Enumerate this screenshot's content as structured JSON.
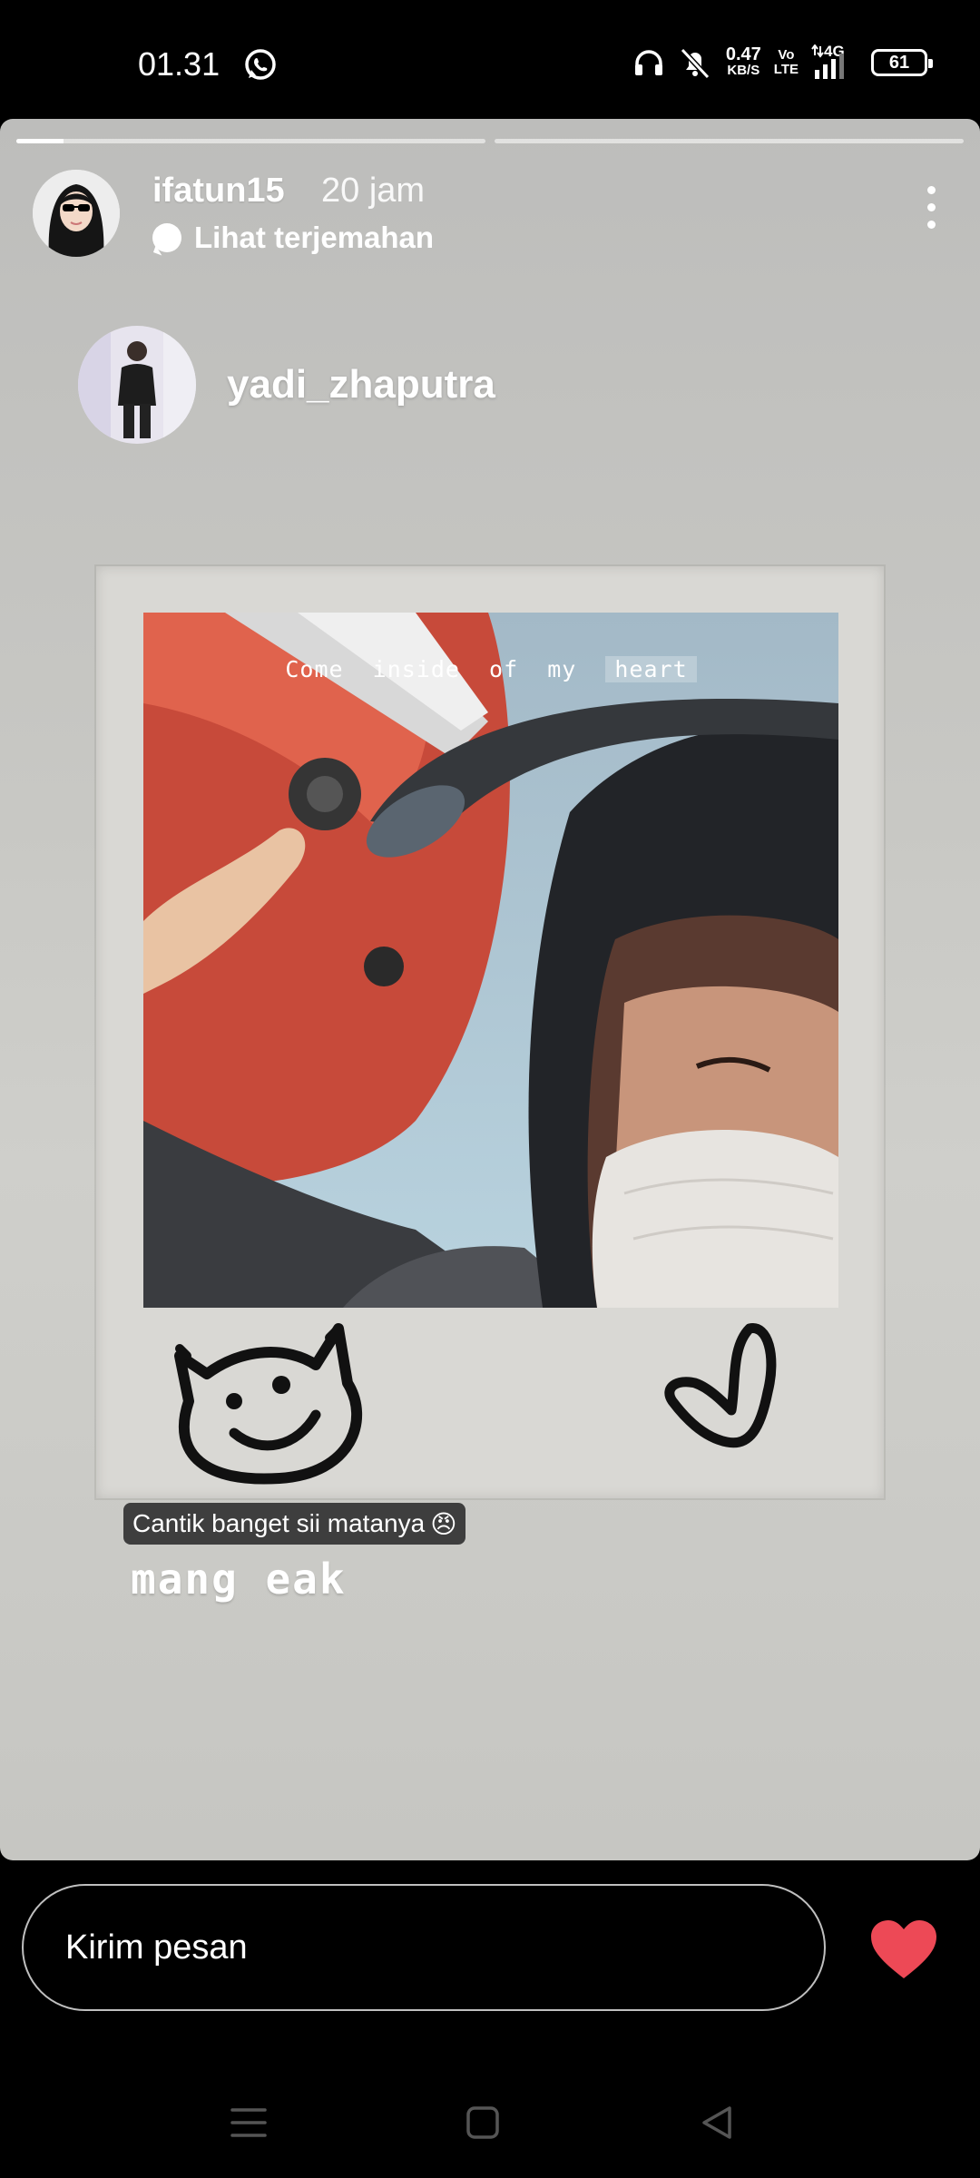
{
  "status_bar": {
    "time": "01.31",
    "net_speed_value": "0.47",
    "net_speed_unit": "KB/S",
    "volte_top": "Vo",
    "volte_bottom": "LTE",
    "network": "4G",
    "battery": "61",
    "icons": [
      "whatsapp-icon",
      "headphones-icon",
      "mute-icon",
      "signal-icon",
      "battery-icon"
    ]
  },
  "story": {
    "progress_segments": [
      0.1,
      0
    ],
    "username": "ifatun15",
    "time_ago": "20 jam",
    "translate_label": "Lihat terjemahan",
    "mention_username": "yadi_zhaputra",
    "photo_caption_words": [
      "Come",
      "inside",
      "of",
      "my"
    ],
    "photo_caption_highlight": "heart",
    "comment_tag": "Cantik banget sii matanya",
    "comment_emoji": "😠",
    "comment_text": "mang eak"
  },
  "reply": {
    "placeholder": "Kirim pesan",
    "like_color": "#ed4956"
  },
  "nav": {
    "icons": [
      "menu-icon",
      "home-icon",
      "back-icon"
    ]
  }
}
